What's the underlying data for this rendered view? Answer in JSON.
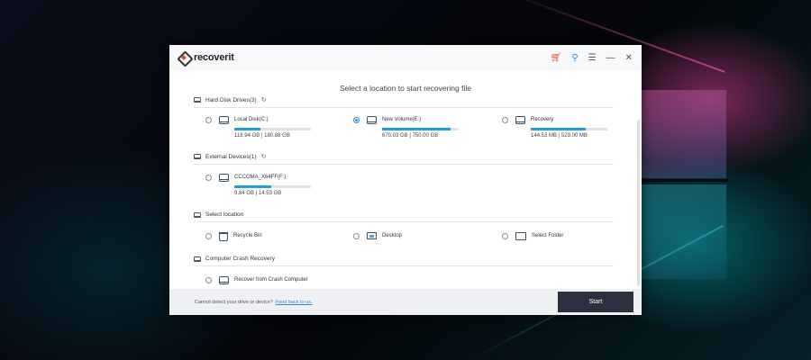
{
  "app": {
    "logo_prefix": "recover",
    "logo_suffix": "it",
    "controls": [
      "cart-icon",
      "key-icon",
      "menu-icon",
      "minimize-icon",
      "close-icon"
    ],
    "accent_color": "#1ea0df",
    "brand_color": "#e4452b"
  },
  "main": {
    "heading": "Select a location to start recovering file"
  },
  "hard_disk": {
    "title": "Hard Disk Drives(3)",
    "drives": [
      {
        "label": "Local Disk(C:)",
        "size": "118.94  GB | 180.88  GB",
        "used_fraction": 0.34,
        "selected": false
      },
      {
        "label": "New Volume(E:)",
        "size": "670.03  GB | 750.00  GB",
        "used_fraction": 0.89,
        "selected": true
      },
      {
        "label": "Recovery",
        "size": "144.53  MB | 529.00  MB",
        "used_fraction": 0.72,
        "selected": false
      }
    ]
  },
  "external": {
    "title": "External Devices(1)",
    "drives": [
      {
        "label": "CCCOMA_X64FF(F:)",
        "size": "9.84  GB | 14.53  GB",
        "used_fraction": 0.48,
        "selected": false
      }
    ]
  },
  "select_location": {
    "title": "Select location",
    "items": [
      {
        "label": "Recycle Bin",
        "icon": "recycle-bin-icon"
      },
      {
        "label": "Desktop",
        "icon": "desktop-icon"
      },
      {
        "label": "Select Folder",
        "icon": "folder-icon"
      }
    ]
  },
  "crash": {
    "title": "Computer Crash Recovery",
    "item_label": "Recover from Crash Computer"
  },
  "footer": {
    "text": "Cannot detect your drive or device?",
    "link": "Feed back to us.",
    "start_label": "Start"
  }
}
